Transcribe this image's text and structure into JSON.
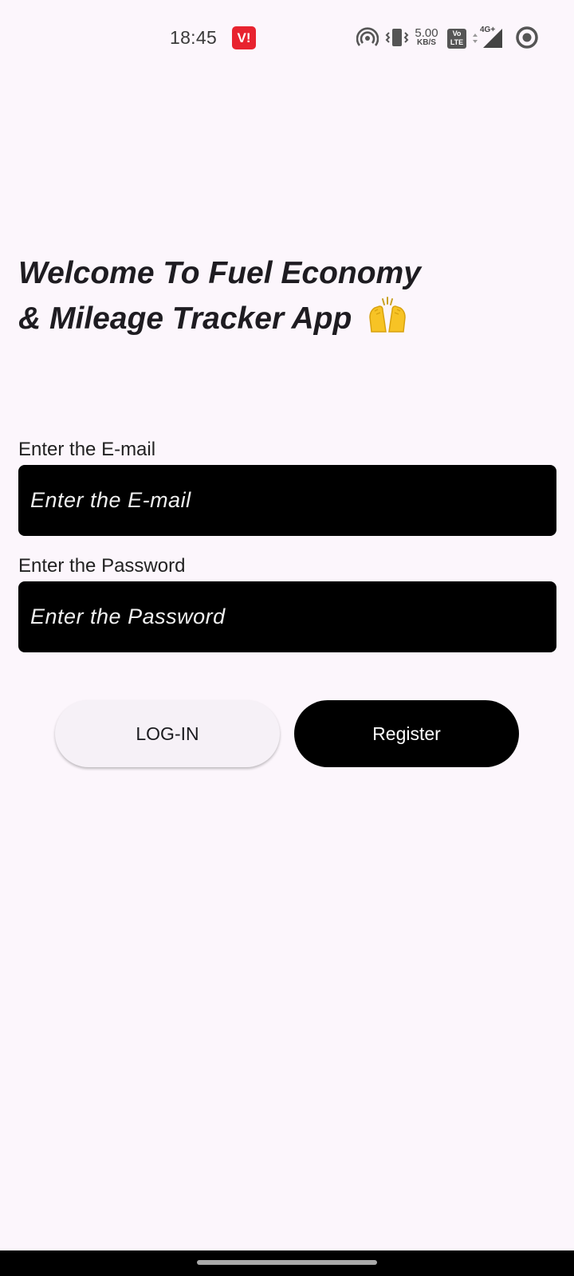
{
  "status_bar": {
    "time": "18:45",
    "carrier_badge": "V!",
    "net_speed_value": "5.00",
    "net_speed_unit": "KB/S",
    "volte_top": "Vo",
    "volte_bottom": "LTE",
    "network_type": "4G+",
    "icons": [
      "hotspot-icon",
      "vibrate-icon",
      "volte-icon",
      "signal-icon",
      "ring-icon"
    ]
  },
  "welcome": {
    "line1": "Welcome To Fuel Economy",
    "line2": "& Mileage Tracker App",
    "emoji_icon": "raising-hands-icon"
  },
  "form": {
    "email_label": "Enter the E-mail",
    "email_placeholder": "Enter the E-mail",
    "email_value": "",
    "password_label": "Enter the Password",
    "password_placeholder": "Enter the Password",
    "password_value": ""
  },
  "buttons": {
    "login": "LOG-IN",
    "register": "Register"
  },
  "colors": {
    "background": "#fcf6fc",
    "input_bg": "#000000",
    "login_bg": "#f6f1f7",
    "register_bg": "#000000",
    "carrier_badge": "#e8232f"
  }
}
